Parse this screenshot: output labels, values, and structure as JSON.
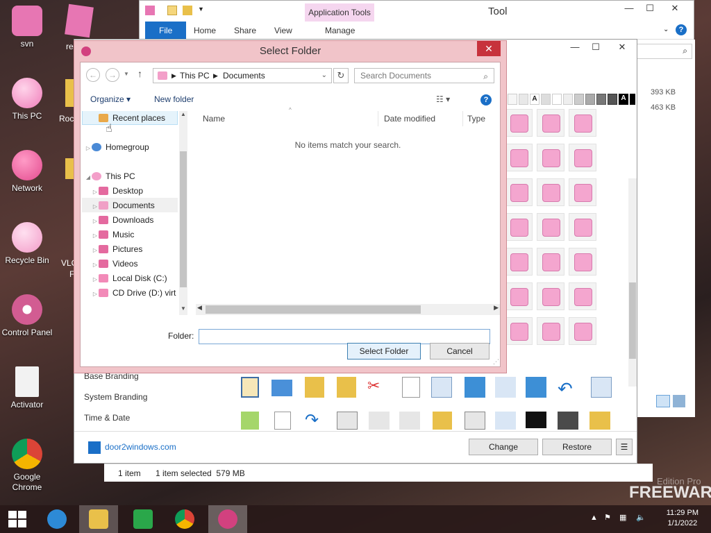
{
  "desktop": {
    "icons": [
      {
        "label": "svn",
        "color": "#e776b3"
      },
      {
        "label": "This PC",
        "color": "#ef7cb9"
      },
      {
        "label": "Network",
        "color": "#e34b8f"
      },
      {
        "label": "Recycle Bin",
        "color": "#f29bc8"
      },
      {
        "label": "Control Panel",
        "color": "#d25c92"
      },
      {
        "label": "Activator",
        "color": "#e6e6e6"
      },
      {
        "label": "Google Chrome",
        "color": "#3b8d3b"
      }
    ],
    "partial_labels": [
      "re",
      "Roc",
      "VLC",
      "F"
    ]
  },
  "explorer_window": {
    "app_tools_label": "Application Tools",
    "title": "Tool",
    "tabs": [
      "File",
      "Home",
      "Share",
      "View",
      "Manage"
    ],
    "sizes": [
      "393 KB",
      "463 KB"
    ]
  },
  "tool_window": {
    "side_items": [
      "Base Branding",
      "System Branding",
      "Time & Date"
    ],
    "link": "door2windows.com",
    "change_button": "Change",
    "restore_button": "Restore",
    "menu_button": "☰",
    "swatch_letter": "A"
  },
  "status_bar": {
    "count": "1 item",
    "selected": "1 item selected  579 MB"
  },
  "dialog": {
    "title": "Select Folder",
    "breadcrumb": [
      "This PC",
      "Documents"
    ],
    "search_placeholder": "Search Documents",
    "organize_label": "Organize ▾",
    "new_folder_label": "New folder",
    "tree": [
      {
        "label": "Recent places",
        "indent": 1,
        "color": "#e9a94a",
        "expander": ""
      },
      {
        "label": "Homegroup",
        "indent": 0,
        "color": "#4a8ad6",
        "expander": "▷"
      },
      {
        "label": "This PC",
        "indent": 0,
        "color": "#f39fc9",
        "expander": "◢"
      },
      {
        "label": "Desktop",
        "indent": 1,
        "color": "#e46a9f",
        "expander": "▷"
      },
      {
        "label": "Documents",
        "indent": 1,
        "color": "#f0a0c6",
        "expander": "▷"
      },
      {
        "label": "Downloads",
        "indent": 1,
        "color": "#e46a9f",
        "expander": "▷"
      },
      {
        "label": "Music",
        "indent": 1,
        "color": "#e46a9f",
        "expander": "▷"
      },
      {
        "label": "Pictures",
        "indent": 1,
        "color": "#e46a9f",
        "expander": "▷"
      },
      {
        "label": "Videos",
        "indent": 1,
        "color": "#e46a9f",
        "expander": "▷"
      },
      {
        "label": "Local Disk (C:)",
        "indent": 1,
        "color": "#f28ab8",
        "expander": "▷"
      },
      {
        "label": "CD Drive (D:) virt",
        "indent": 1,
        "color": "#f28ab8",
        "expander": "▷"
      }
    ],
    "columns": [
      "Name",
      "Date modified",
      "Type"
    ],
    "empty_message": "No items match your search.",
    "folder_label": "Folder:",
    "folder_value": "",
    "select_button": "Select Folder",
    "cancel_button": "Cancel"
  },
  "taskbar": {
    "items": [
      {
        "name": "start",
        "color": "#ffffff"
      },
      {
        "name": "ie",
        "color": "#2d8ad6"
      },
      {
        "name": "file-explorer",
        "color": "#e9c04a"
      },
      {
        "name": "store",
        "color": "#2aa74a"
      },
      {
        "name": "chrome",
        "color": "#d9433b"
      },
      {
        "name": "tool-app",
        "color": "#e776b3"
      }
    ],
    "time": "11:29 PM",
    "date": "1/1/2022",
    "watermark_edition": "Edition Pro",
    "watermark_brand": "FREEWARE"
  }
}
